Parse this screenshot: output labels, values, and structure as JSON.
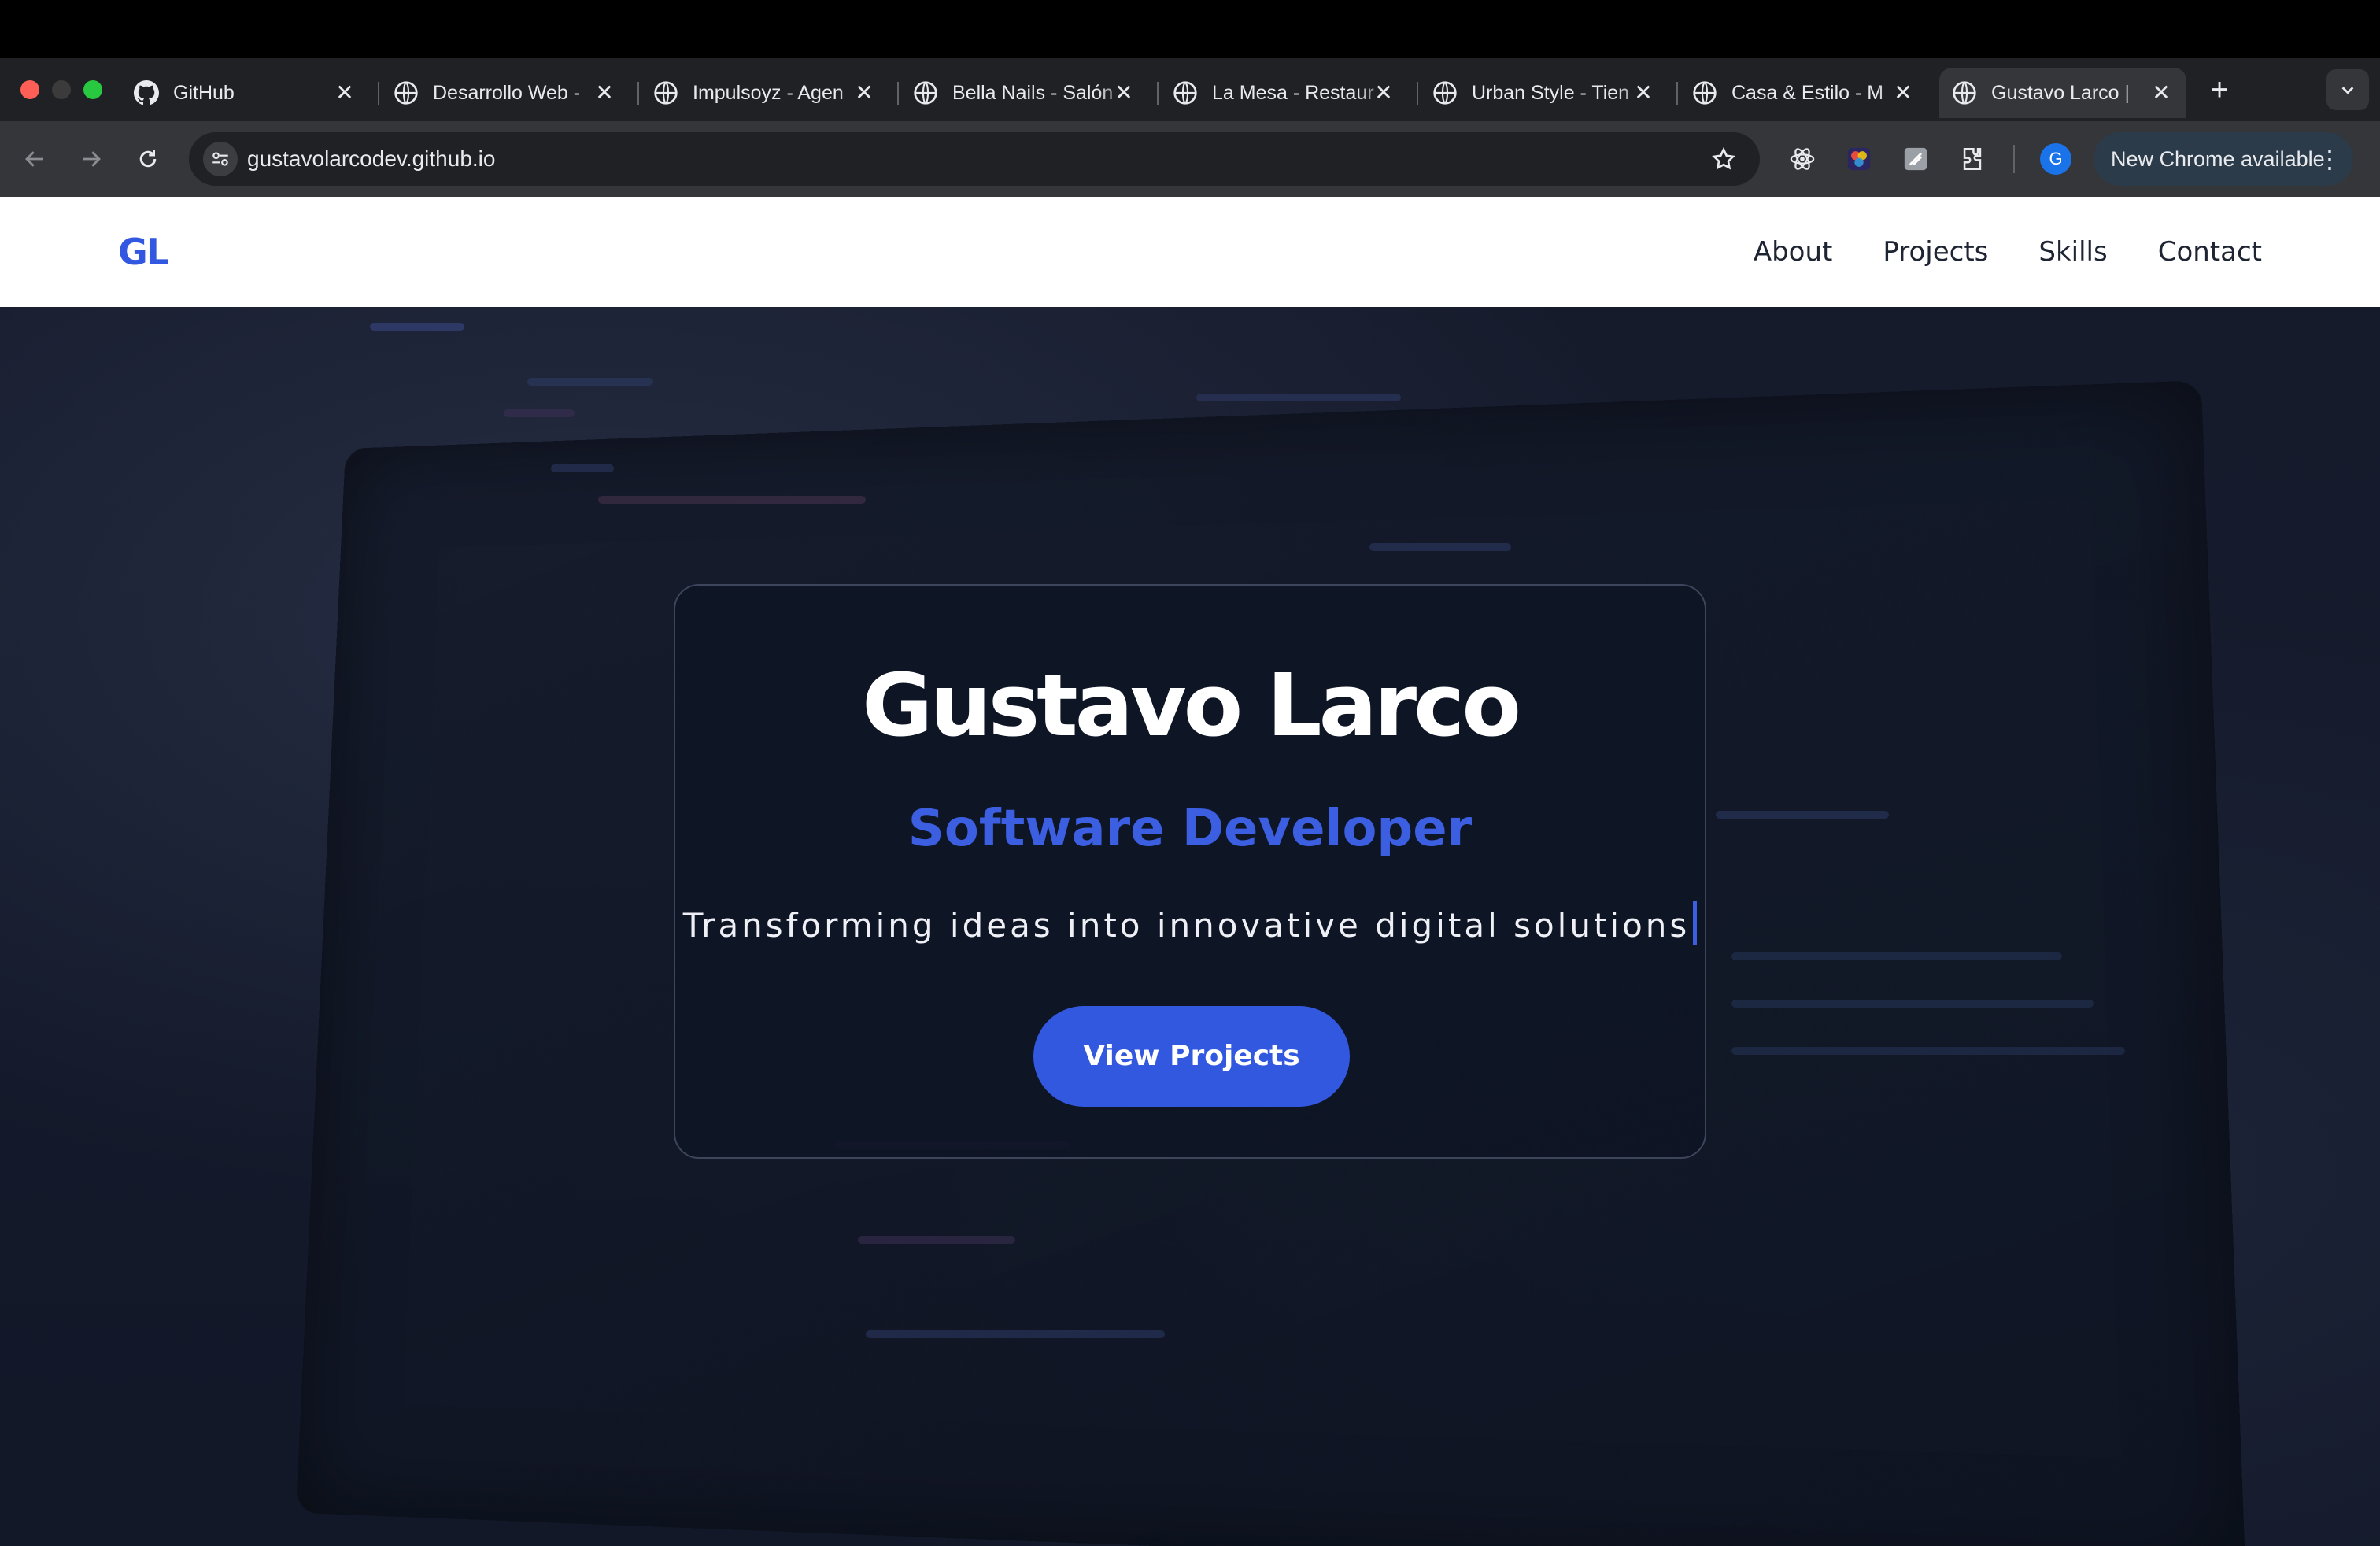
{
  "browser": {
    "tabs": [
      {
        "title": "GitHub",
        "icon": "github-icon"
      },
      {
        "title": "Desarrollo Web - ",
        "icon": "globe-icon"
      },
      {
        "title": "Impulsoyz - Agen",
        "icon": "globe-icon"
      },
      {
        "title": "Bella Nails - Salón",
        "icon": "globe-icon"
      },
      {
        "title": "La Mesa - Restaur",
        "icon": "globe-icon"
      },
      {
        "title": "Urban Style - Tien",
        "icon": "globe-icon"
      },
      {
        "title": "Casa & Estilo - M",
        "icon": "globe-icon"
      },
      {
        "title": "Gustavo Larco | ",
        "icon": "globe-icon",
        "active": true
      }
    ],
    "close_glyph": "✕",
    "new_tab_glyph": "+",
    "url": "gustavolarcodev.github.io",
    "profile_initial": "G",
    "update_label": "New Chrome available",
    "menu_glyph": "⋮"
  },
  "site": {
    "logo": "GL",
    "nav": [
      "About",
      "Projects",
      "Skills",
      "Contact"
    ],
    "hero": {
      "name": "Gustavo Larco",
      "role": "Software Developer",
      "tagline": "Transforming ideas into innovative digital solutions",
      "cta": "View Projects"
    }
  },
  "colors": {
    "accent": "#3358e0",
    "hero_bg": "#141a2b",
    "nav_bg": "#ffffff",
    "chrome_dark": "#202124"
  }
}
